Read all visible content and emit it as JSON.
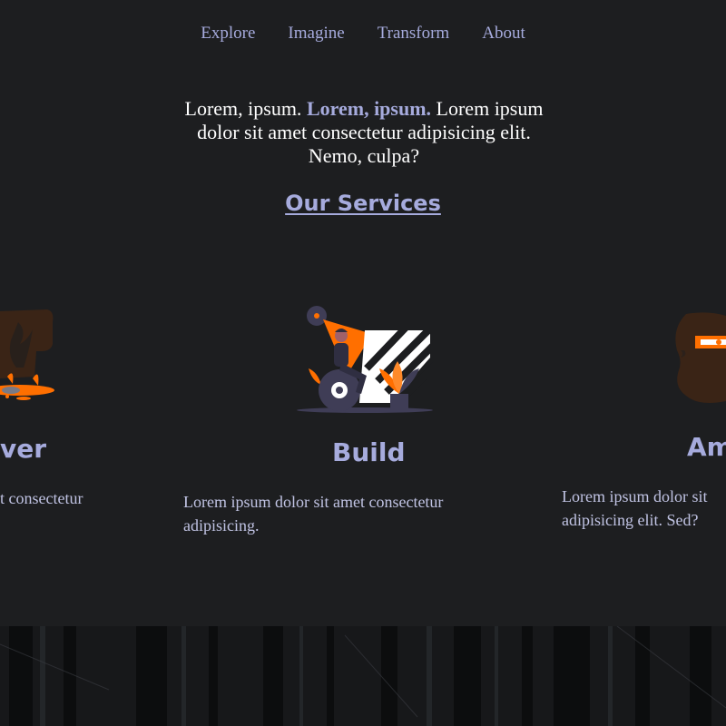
{
  "colors": {
    "accent": "#a6abdd",
    "accent2": "#c0c3e3",
    "background": "#1d1e20",
    "orange": "#ff6f00",
    "purple_gray": "#3f3d56"
  },
  "nav": {
    "items": [
      {
        "label": "Explore"
      },
      {
        "label": "Imagine"
      },
      {
        "label": "Transform"
      },
      {
        "label": "About"
      }
    ]
  },
  "hero": {
    "text_a": "Lorem, ipsum.",
    "text_em": "Lorem, ipsum.",
    "text_b": "Lorem ipsum dolor sit amet consectetur adipisicing elit. Nemo, culpa?"
  },
  "services": {
    "title": "Our Services",
    "cards": [
      {
        "title": "ver",
        "text": "t consectetur",
        "icon": "discover-illustration-icon"
      },
      {
        "title": "Build",
        "text": "Lorem ipsum dolor sit amet consectetur adipisicing.",
        "icon": "build-illustration-icon"
      },
      {
        "title": "Am",
        "text": "Lorem ipsum dolor sit adipisicing elit. Sed?",
        "icon": "amaze-illustration-icon"
      }
    ]
  }
}
